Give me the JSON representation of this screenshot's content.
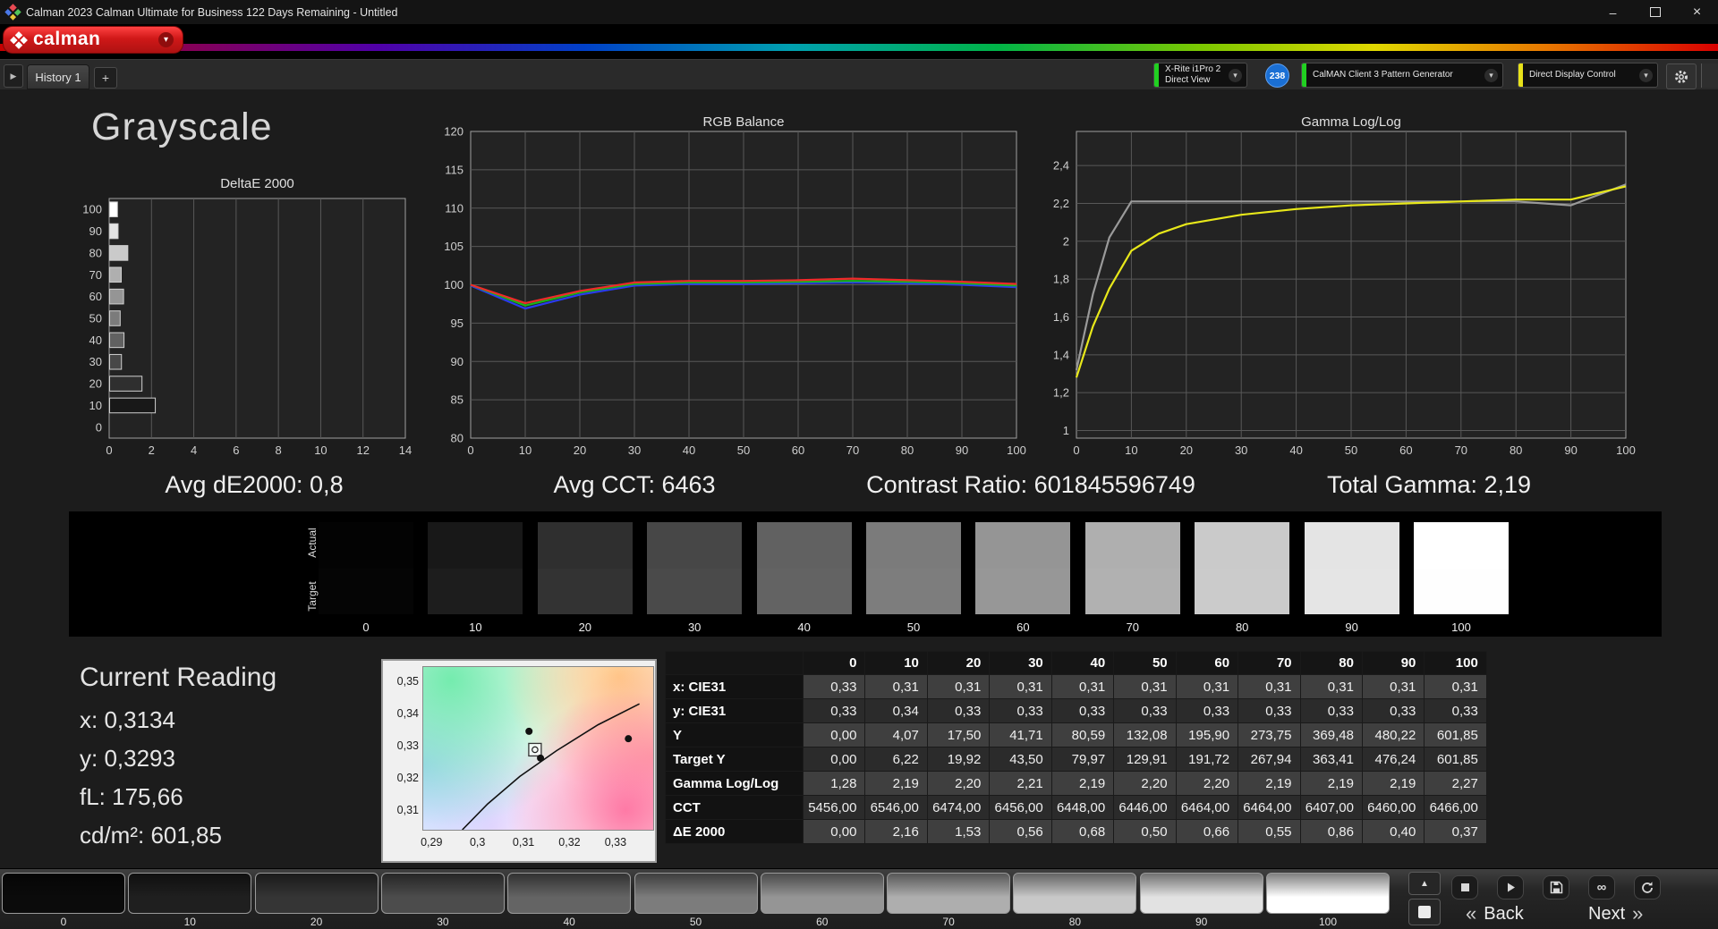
{
  "window": {
    "title": "Calman 2023 Calman Ultimate for Business 122 Days Remaining  - Untitled"
  },
  "icons": {
    "dropdown": "▾",
    "minimize": "–",
    "close": "×",
    "history_expand": "▶",
    "add_tab": "+",
    "eject": "▲",
    "infinity": "∞"
  },
  "brand": {
    "name": "calman"
  },
  "tabbar": {
    "tabs": [
      {
        "label": "History 1"
      }
    ],
    "meter": {
      "line1": "X-Rite i1Pro 2",
      "line2": "Direct View",
      "accent": "#21d021",
      "badge": "238"
    },
    "pattern_generator": {
      "label": "CalMAN Client 3 Pattern Generator",
      "accent": "#21d021"
    },
    "display_control": {
      "label": "Direct Display Control",
      "accent": "#e8e21a"
    }
  },
  "page": {
    "title": "Grayscale"
  },
  "stats": {
    "avg_de": "Avg dE2000: 0,8",
    "avg_cct": "Avg CCT: 6463",
    "contrast": "Contrast Ratio: 601845596749",
    "total_gamma": "Total Gamma: 2,19"
  },
  "swatch_strip": {
    "row_labels": [
      "Actual",
      "Target"
    ],
    "levels": [
      "0",
      "10",
      "20",
      "30",
      "40",
      "50",
      "60",
      "70",
      "80",
      "90",
      "100"
    ],
    "actual_colors": [
      "#030303",
      "#181818",
      "#2f2f2f",
      "#474747",
      "#616161",
      "#7b7b7b",
      "#959595",
      "#afafaf",
      "#cacaca",
      "#e4e4e4",
      "#ffffff"
    ],
    "target_colors": [
      "#050505",
      "#1d1d1d",
      "#333333",
      "#4a4a4a",
      "#636363",
      "#7d7d7d",
      "#979797",
      "#b1b1b1",
      "#cbcbcb",
      "#e5e5e5",
      "#fefefe"
    ]
  },
  "current_reading": {
    "title": "Current Reading",
    "lines": [
      "x: 0,3134",
      "y: 0,3293",
      "fL: 175,66",
      "cd/m²: 601,85"
    ]
  },
  "cie": {
    "xlim": [
      0.288,
      0.338
    ],
    "ylim": [
      0.3045,
      0.3549
    ],
    "xtick_values": [
      0.29,
      0.3,
      0.31,
      0.32,
      0.33
    ],
    "xtick_labels": [
      "0,29",
      "0,3",
      "0,31",
      "0,32",
      "0,33"
    ],
    "ytick_values": [
      0.35,
      0.34,
      0.33,
      0.32,
      0.31
    ],
    "ytick_labels": [
      "0,35",
      "0,34",
      "0,33",
      "0,32",
      "0,31"
    ],
    "locus": [
      [
        0.2965,
        0.3045
      ],
      [
        0.302,
        0.3125
      ],
      [
        0.309,
        0.321
      ],
      [
        0.317,
        0.329
      ],
      [
        0.326,
        0.337
      ],
      [
        0.335,
        0.3435
      ]
    ],
    "markers": [
      {
        "type": "dot",
        "x": 0.311,
        "y": 0.335
      },
      {
        "type": "dot",
        "x": 0.3326,
        "y": 0.3327
      },
      {
        "type": "square",
        "x": 0.3123,
        "y": 0.3293
      },
      {
        "type": "dot",
        "x": 0.3135,
        "y": 0.3267
      }
    ]
  },
  "table": {
    "columns": [
      "0",
      "10",
      "20",
      "30",
      "40",
      "50",
      "60",
      "70",
      "80",
      "90",
      "100"
    ],
    "rows": [
      {
        "label": "x: CIE31",
        "values": [
          "0,33",
          "0,31",
          "0,31",
          "0,31",
          "0,31",
          "0,31",
          "0,31",
          "0,31",
          "0,31",
          "0,31",
          "0,31"
        ]
      },
      {
        "label": "y: CIE31",
        "values": [
          "0,33",
          "0,34",
          "0,33",
          "0,33",
          "0,33",
          "0,33",
          "0,33",
          "0,33",
          "0,33",
          "0,33",
          "0,33"
        ]
      },
      {
        "label": "Y",
        "values": [
          "0,00",
          "4,07",
          "17,50",
          "41,71",
          "80,59",
          "132,08",
          "195,90",
          "273,75",
          "369,48",
          "480,22",
          "601,85"
        ]
      },
      {
        "label": "Target Y",
        "values": [
          "0,00",
          "6,22",
          "19,92",
          "43,50",
          "79,97",
          "129,91",
          "191,72",
          "267,94",
          "363,41",
          "476,24",
          "601,85"
        ]
      },
      {
        "label": "Gamma Log/Log",
        "values": [
          "1,28",
          "2,19",
          "2,20",
          "2,21",
          "2,19",
          "2,20",
          "2,20",
          "2,19",
          "2,19",
          "2,19",
          "2,27"
        ]
      },
      {
        "label": "CCT",
        "values": [
          "5456,00",
          "6546,00",
          "6474,00",
          "6456,00",
          "6448,00",
          "6446,00",
          "6464,00",
          "6464,00",
          "6407,00",
          "6460,00",
          "6466,00"
        ]
      },
      {
        "label": "ΔE 2000",
        "values": [
          "0,00",
          "2,16",
          "1,53",
          "0,56",
          "0,68",
          "0,50",
          "0,66",
          "0,55",
          "0,86",
          "0,40",
          "0,37"
        ]
      }
    ]
  },
  "chart_data": [
    {
      "id": "deltae",
      "type": "bar",
      "orientation": "horizontal",
      "title": "DeltaE 2000",
      "categories": [
        "100",
        "90",
        "80",
        "70",
        "60",
        "50",
        "40",
        "30",
        "20",
        "10",
        "0"
      ],
      "values": [
        0.37,
        0.4,
        0.86,
        0.55,
        0.66,
        0.5,
        0.68,
        0.56,
        1.53,
        2.16,
        0.0
      ],
      "colors": [
        "#ffffff",
        "#e4e4e4",
        "#cacaca",
        "#afafaf",
        "#959595",
        "#7b7b7b",
        "#616161",
        "#474747",
        "#2f2f2f",
        "#181818",
        "#000000"
      ],
      "xlim": [
        0,
        14
      ],
      "xticks": [
        0,
        2,
        4,
        6,
        8,
        10,
        12,
        14
      ],
      "xtick_labels": [
        "0",
        "2",
        "4",
        "6",
        "8",
        "10",
        "12",
        "14"
      ]
    },
    {
      "id": "rgb_balance",
      "type": "line",
      "title": "RGB Balance",
      "x": [
        0,
        10,
        20,
        30,
        40,
        50,
        60,
        70,
        80,
        90,
        100
      ],
      "series": [
        {
          "name": "blue",
          "color": "#2a3cf0",
          "values": [
            99.9,
            96.9,
            98.7,
            99.9,
            100.1,
            100.1,
            100.2,
            100.3,
            100.2,
            100.0,
            99.7
          ]
        },
        {
          "name": "green",
          "color": "#1ab41a",
          "values": [
            100.0,
            97.3,
            99.0,
            100.1,
            100.3,
            100.3,
            100.4,
            100.5,
            100.4,
            100.2,
            99.9
          ]
        },
        {
          "name": "red",
          "color": "#f02a2a",
          "values": [
            100.0,
            97.6,
            99.2,
            100.3,
            100.5,
            100.5,
            100.6,
            100.8,
            100.6,
            100.4,
            100.1
          ]
        }
      ],
      "xlim": [
        0,
        100
      ],
      "ylim": [
        80,
        120
      ],
      "xticks": [
        0,
        10,
        20,
        30,
        40,
        50,
        60,
        70,
        80,
        90,
        100
      ],
      "xtick_labels": [
        "0",
        "10",
        "20",
        "30",
        "40",
        "50",
        "60",
        "70",
        "80",
        "90",
        "100"
      ],
      "yticks": [
        80,
        85,
        90,
        95,
        100,
        105,
        110,
        115,
        120
      ],
      "ytick_labels": [
        "80",
        "85",
        "90",
        "95",
        "100",
        "105",
        "110",
        "115",
        "120"
      ]
    },
    {
      "id": "gamma",
      "type": "line",
      "title": "Gamma Log/Log",
      "x": [
        0,
        3,
        6,
        10,
        15,
        20,
        30,
        40,
        50,
        60,
        70,
        80,
        90,
        100
      ],
      "series": [
        {
          "name": "target",
          "color": "#9a9a9a",
          "values": [
            1.32,
            1.72,
            2.02,
            2.21,
            2.21,
            2.21,
            2.21,
            2.21,
            2.21,
            2.21,
            2.21,
            2.21,
            2.19,
            2.3
          ]
        },
        {
          "name": "measured",
          "color": "#e8e81a",
          "values": [
            1.28,
            1.55,
            1.75,
            1.95,
            2.04,
            2.09,
            2.14,
            2.17,
            2.19,
            2.2,
            2.21,
            2.22,
            2.22,
            2.29
          ]
        }
      ],
      "xlim": [
        0,
        100
      ],
      "ylim": [
        0.96,
        2.58
      ],
      "xticks": [
        0,
        10,
        20,
        30,
        40,
        50,
        60,
        70,
        80,
        90,
        100
      ],
      "xtick_labels": [
        "0",
        "10",
        "20",
        "30",
        "40",
        "50",
        "60",
        "70",
        "80",
        "90",
        "100"
      ],
      "yticks": [
        1,
        1.2,
        1.4,
        1.6,
        1.8,
        2,
        2.2,
        2.4
      ],
      "ytick_labels": [
        "1",
        "1,2",
        "1,4",
        "1,6",
        "1,8",
        "2",
        "2,2",
        "2,4"
      ]
    }
  ],
  "bottombar": {
    "patch_labels": [
      "0",
      "10",
      "20",
      "30",
      "40",
      "50",
      "60",
      "70",
      "80",
      "90",
      "100"
    ],
    "patch_colors": [
      "#0b0b0b",
      "#1f1f1f",
      "#353535",
      "#4c4c4c",
      "#646464",
      "#7c7c7c",
      "#959595",
      "#aeaeae",
      "#c8c8c8",
      "#e2e2e2",
      "#ffffff"
    ],
    "nav": {
      "back": "Back",
      "next": "Next",
      "back_chev": "«",
      "next_chev": "»"
    }
  }
}
